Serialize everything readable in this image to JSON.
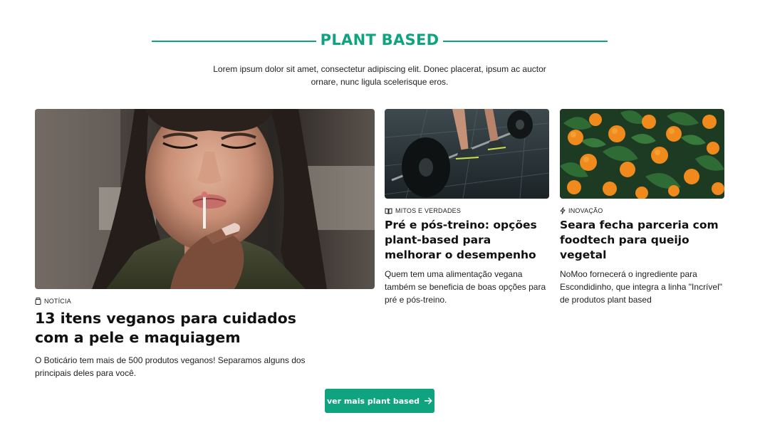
{
  "section": {
    "title": "PLANT BASED",
    "description": "Lorem ipsum dolor sit amet, consectetur adipiscing elit. Donec placerat, ipsum ac auctor ornare, nunc ligula scelerisque eros."
  },
  "articles": [
    {
      "tag": "NOTÍCIA",
      "tag_icon": "jar-icon",
      "image": "woman-applying-lip-gloss-photo",
      "headline": "13 itens veganos para cuidados com a pele e maquiagem",
      "summary": "O Boticário tem mais de 500 produtos veganos! Separamos alguns dos principais deles para você."
    },
    {
      "tag": "MITOS E VERDADES",
      "tag_icon": "book-icon",
      "image": "barbell-deadlift-photo",
      "headline": "Pré e pós-treino: opções plant-based para melhorar o desempenho",
      "summary": "Quem tem uma alimentação vegana também se beneficia de boas opções para pré e pós-treino."
    },
    {
      "tag": "INOVAÇÃO",
      "tag_icon": "lightning-icon",
      "image": "oranges-on-tree-photo",
      "headline": "Seara fecha parceria com foodtech para queijo vegetal",
      "summary": "NoMoo fornecerá o ingrediente para Escondidinho, que integra a linha \"Incrível\" de produtos plant based"
    }
  ],
  "cta": {
    "label": "ver mais plant based",
    "icon": "arrow-right-icon"
  },
  "colors": {
    "accent": "#0fa37f",
    "text": "#1a1a1a"
  }
}
